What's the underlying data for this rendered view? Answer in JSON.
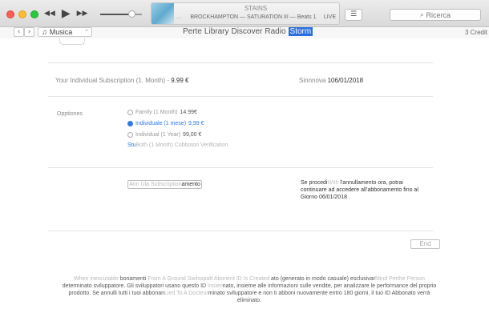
{
  "titlebar": {
    "now_playing_title": "STAINS",
    "now_playing_artist": "BROCKHAMPTON — SATURATION III — Beats 1",
    "now_playing_dots": "....",
    "live_label": "LIVE",
    "volume_level": 0.75,
    "search_placeholder": "Ricerca"
  },
  "navbar": {
    "back_glyph": "‹",
    "forward_glyph": "›",
    "media_label": "Musica",
    "tabs": [
      "Perte",
      "Library",
      "Discover",
      "Radio",
      "Storm"
    ],
    "active_tab_index": 4,
    "credit": "3 Credit"
  },
  "subscription": {
    "label_prefix": "Your Individual Subscription (1. Month) - ",
    "price": "9.99 €",
    "renew_prefix": "Sinnnova ",
    "renew_date": "106/01/2018"
  },
  "options": {
    "label": "Opptiones",
    "items": [
      {
        "label": "Family (1 Month) ",
        "value": "14.99€",
        "selected": false
      },
      {
        "label": "Individuale (1 mese) ",
        "value": "9,99 €",
        "selected": true
      },
      {
        "label": "Individual (1 Year) ",
        "value": "99,00 €",
        "selected": false
      }
    ],
    "link_text": "Stu",
    "link_faded": "Both (1 Month) Cobbotori Verification"
  },
  "cancel": {
    "button_faded": "Ann Ula Subscription",
    "button_text": "amento",
    "notice_line1_a": "Se procedi",
    "notice_line1_faded": "With",
    "notice_line1_b": " l'annullamento ora, potrai",
    "notice_line2": "continuare ad accedere all'abbonamento fino al",
    "notice_line3": "Giorno 06/01/2018 ."
  },
  "end_button": "End",
  "footer": {
    "l1_a": "When inexcutable ",
    "l1_b": "bonamenti ",
    "l1_faded1": "From A Ground Swilsspatt Abonent ID Is Created ",
    "l1_c": "ato (generato in modo casuale) esclusivar",
    "l1_faded2": "Mind Perthe Person",
    "l2_a": "determinato sviluppatore. Gli sviluppatori usano questo ID ",
    "l2_faded": "Insieri",
    "l2_b": "nato, insieme alle informazioni sulle vendite, per analizzare le performance del proprio",
    "l3_a": "prodotto. Se annulli tutti i tuoi abbonan",
    "l3_faded": "Lied To A Docteur",
    "l3_b": "minato sviluppatore e non ti abboni nuovamente entro 180 giorni, il tuo ID Abbonato verrà",
    "l4": "eliminato."
  },
  "colors": {
    "accent": "#2e7ae6",
    "traffic_red": "#fc5f57",
    "traffic_yellow": "#fdbc2e",
    "traffic_green": "#28c840"
  }
}
